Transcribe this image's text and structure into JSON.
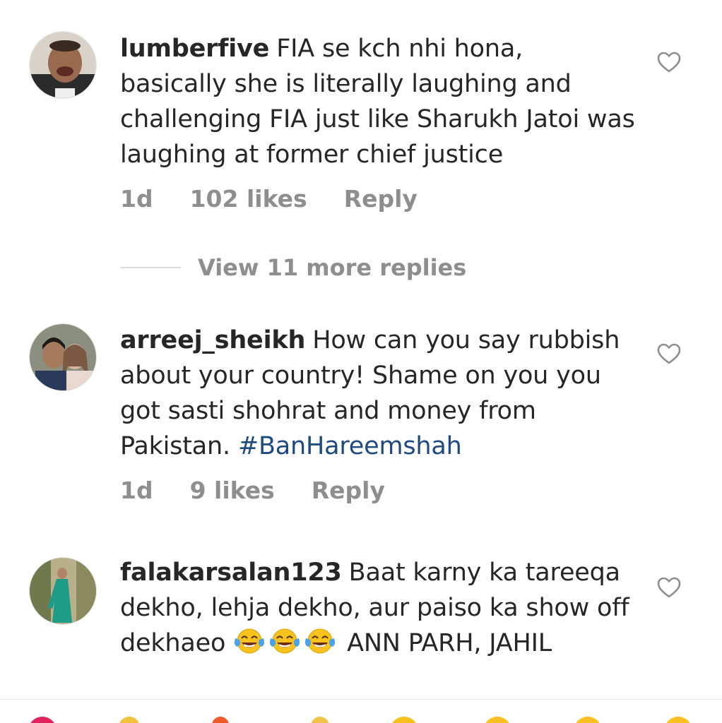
{
  "comments": [
    {
      "username": "lumberfive",
      "text": "FIA se kch nhi hona, basically she is literally laughing and challenging FIA just like Sharukh Jatoi was laughing at former chief justice",
      "time": "1d",
      "likes": "102 likes",
      "reply": "Reply"
    },
    {
      "username": "arreej_sheikh",
      "text": "How can you say rubbish about your country! Shame on you you got sasti shohrat and money from Pakistan.",
      "hashtag": "#BanHareemshah",
      "time": "1d",
      "likes": "9 likes",
      "reply": "Reply"
    },
    {
      "username": "falakarsalan123",
      "text_before": "Baat karny ka tareeqa dekho, lehja dekho, aur paiso ka show off dekhaeo",
      "emojis": [
        "face-with-tears-of-joy",
        "face-with-tears-of-joy",
        "face-with-tears-of-joy"
      ],
      "text_after": "ANN PARH, JAHIL"
    }
  ],
  "view_replies": "View 11 more replies",
  "colors": {
    "text": "#262626",
    "secondary": "#8e8e8e",
    "hashtag": "#1d4a82"
  }
}
